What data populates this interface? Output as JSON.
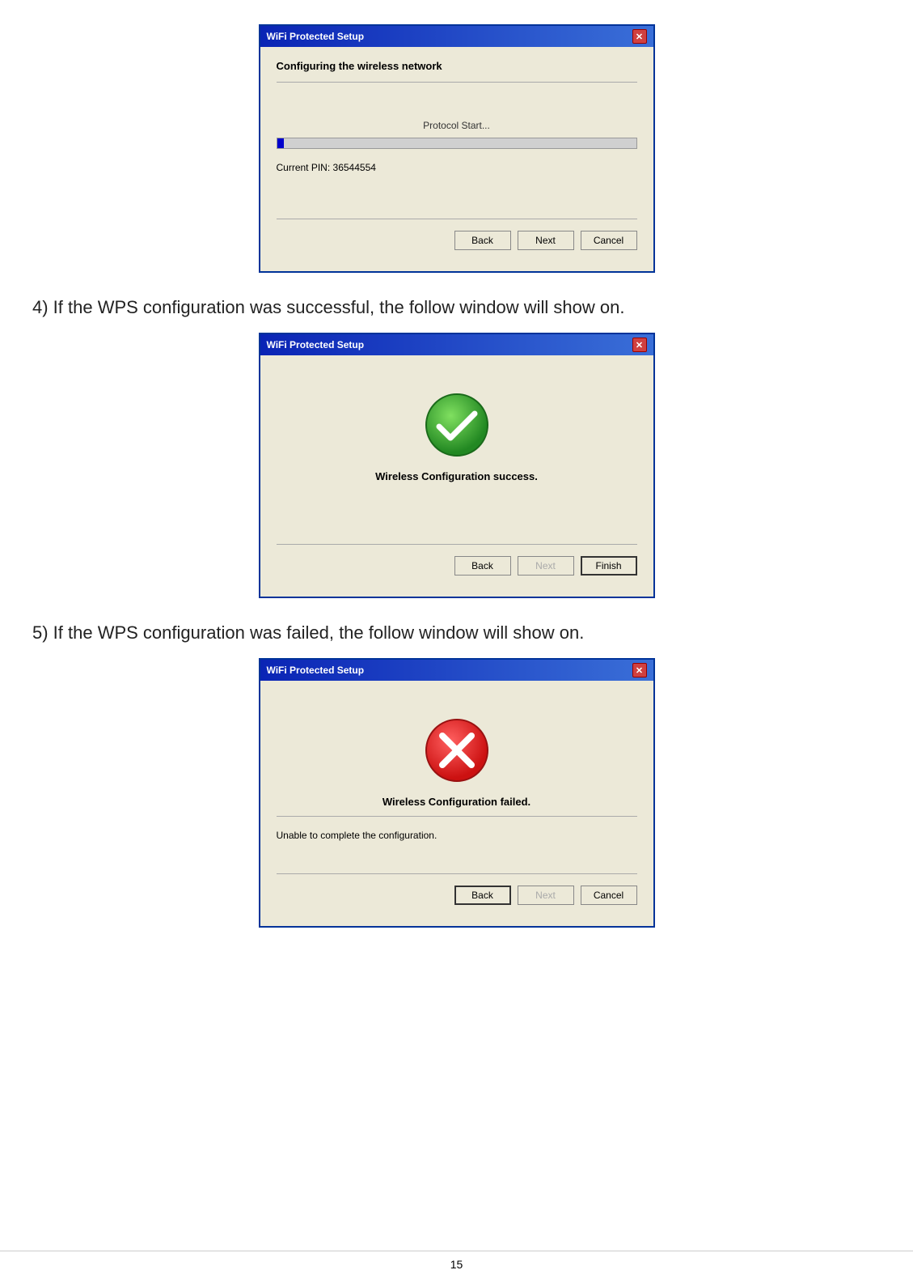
{
  "page": {
    "number": "15"
  },
  "section1": {
    "dialog": {
      "title": "WiFi Protected Setup",
      "heading": "Configuring the wireless network",
      "protocol_label": "Protocol Start...",
      "pin_label": "Current PIN: 36544554",
      "buttons": {
        "back": "Back",
        "next": "Next",
        "cancel": "Cancel"
      }
    }
  },
  "section2": {
    "instruction": "4) If the WPS configuration was successful, the follow window will show on.",
    "dialog": {
      "title": "WiFi Protected Setup",
      "main_text": "Wireless Configuration success.",
      "buttons": {
        "back": "Back",
        "next": "Next",
        "finish": "Finish"
      }
    }
  },
  "section3": {
    "instruction": "5) If the WPS configuration was failed, the follow window will show on.",
    "dialog": {
      "title": "WiFi Protected Setup",
      "main_text": "Wireless Configuration failed.",
      "sub_text": "Unable to complete the configuration.",
      "buttons": {
        "back": "Back",
        "next": "Next",
        "cancel": "Cancel"
      }
    }
  }
}
